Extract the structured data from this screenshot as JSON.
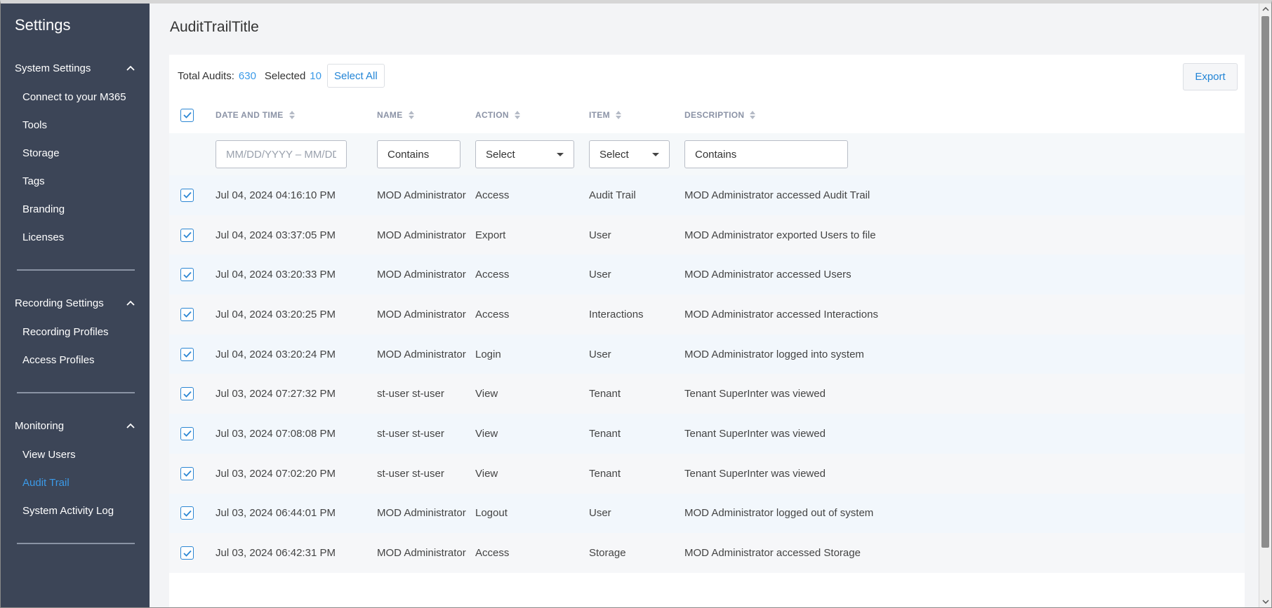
{
  "sidebar": {
    "title": "Settings",
    "sections": [
      {
        "label": "System Settings",
        "items": [
          "Connect to your M365",
          "Tools",
          "Storage",
          "Tags",
          "Branding",
          "Licenses"
        ]
      },
      {
        "label": "Recording Settings",
        "items": [
          "Recording Profiles",
          "Access Profiles"
        ]
      },
      {
        "label": "Monitoring",
        "items": [
          "View Users",
          "Audit Trail",
          "System Activity Log"
        ],
        "active_item": "Audit Trail"
      }
    ]
  },
  "page": {
    "title": "AuditTrailTitle"
  },
  "toolbar": {
    "total_label": "Total Audits:",
    "total_value": "630",
    "selected_label": "Selected",
    "selected_value": "10",
    "select_all_label": "Select All",
    "export_label": "Export"
  },
  "table": {
    "headers": {
      "date": "DATE AND TIME",
      "name": "NAME",
      "action": "ACTION",
      "item": "ITEM",
      "description": "DESCRIPTION"
    },
    "filters": {
      "date_placeholder": "MM/DD/YYYY – MM/DD/YYYY",
      "name_value": "Contains",
      "action_value": "Select",
      "item_value": "Select",
      "description_value": "Contains"
    },
    "rows": [
      {
        "date": "Jul 04, 2024 04:16:10 PM",
        "name": "MOD Administrator",
        "action": "Access",
        "item": "Audit Trail",
        "description": "MOD Administrator accessed Audit Trail"
      },
      {
        "date": "Jul 04, 2024 03:37:05 PM",
        "name": "MOD Administrator",
        "action": "Export",
        "item": "User",
        "description": "MOD Administrator exported Users to file"
      },
      {
        "date": "Jul 04, 2024 03:20:33 PM",
        "name": "MOD Administrator",
        "action": "Access",
        "item": "User",
        "description": "MOD Administrator accessed Users"
      },
      {
        "date": "Jul 04, 2024 03:20:25 PM",
        "name": "MOD Administrator",
        "action": "Access",
        "item": "Interactions",
        "description": "MOD Administrator accessed Interactions"
      },
      {
        "date": "Jul 04, 2024 03:20:24 PM",
        "name": "MOD Administrator",
        "action": "Login",
        "item": "User",
        "description": "MOD Administrator logged into system"
      },
      {
        "date": "Jul 03, 2024 07:27:32 PM",
        "name": "st-user st-user",
        "action": "View",
        "item": "Tenant",
        "description": "Tenant SuperInter was viewed"
      },
      {
        "date": "Jul 03, 2024 07:08:08 PM",
        "name": "st-user st-user",
        "action": "View",
        "item": "Tenant",
        "description": "Tenant SuperInter was viewed"
      },
      {
        "date": "Jul 03, 2024 07:02:20 PM",
        "name": "st-user st-user",
        "action": "View",
        "item": "Tenant",
        "description": "Tenant SuperInter was viewed"
      },
      {
        "date": "Jul 03, 2024 06:44:01 PM",
        "name": "MOD Administrator",
        "action": "Logout",
        "item": "User",
        "description": "MOD Administrator logged out of system"
      },
      {
        "date": "Jul 03, 2024 06:42:31 PM",
        "name": "MOD Administrator",
        "action": "Access",
        "item": "Storage",
        "description": "MOD Administrator accessed Storage"
      }
    ]
  },
  "colors": {
    "sidebar_bg": "#3c4557",
    "accent": "#3b9ae8",
    "checkbox": "#2b86d3"
  },
  "icons": {
    "section_toggle": "chevron-up-icon",
    "sort": "sort-icon",
    "dropdown": "caret-down-icon",
    "checkbox": "checkbox-checked-icon"
  }
}
